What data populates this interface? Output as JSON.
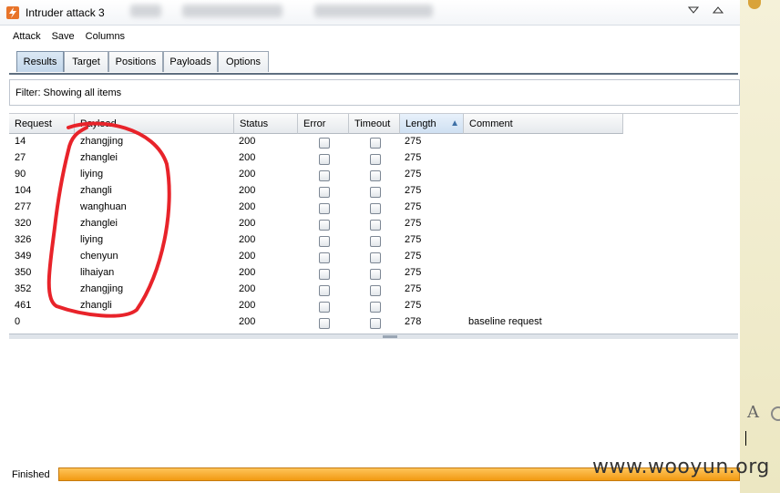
{
  "window": {
    "title": "Intruder attack 3",
    "minimize_icon": "chevron-down-icon",
    "maximize_icon": "chevron-up-icon"
  },
  "menu": {
    "items": [
      "Attack",
      "Save",
      "Columns"
    ]
  },
  "tabs": [
    {
      "label": "Results",
      "active": true
    },
    {
      "label": "Target",
      "active": false
    },
    {
      "label": "Positions",
      "active": false
    },
    {
      "label": "Payloads",
      "active": false
    },
    {
      "label": "Options",
      "active": false
    }
  ],
  "filter": {
    "text": "Filter:  Showing all items"
  },
  "table": {
    "columns": [
      "Request",
      "Payload",
      "Status",
      "Error",
      "Timeout",
      "Length",
      "Comment"
    ],
    "sorted_column": "Length",
    "rows": [
      {
        "request": "14",
        "payload": "zhangjing",
        "status": "200",
        "error": false,
        "timeout": false,
        "length": "275",
        "comment": ""
      },
      {
        "request": "27",
        "payload": "zhanglei",
        "status": "200",
        "error": false,
        "timeout": false,
        "length": "275",
        "comment": ""
      },
      {
        "request": "90",
        "payload": "liying",
        "status": "200",
        "error": false,
        "timeout": false,
        "length": "275",
        "comment": ""
      },
      {
        "request": "104",
        "payload": "zhangli",
        "status": "200",
        "error": false,
        "timeout": false,
        "length": "275",
        "comment": ""
      },
      {
        "request": "277",
        "payload": "wanghuan",
        "status": "200",
        "error": false,
        "timeout": false,
        "length": "275",
        "comment": ""
      },
      {
        "request": "320",
        "payload": "zhanglei",
        "status": "200",
        "error": false,
        "timeout": false,
        "length": "275",
        "comment": ""
      },
      {
        "request": "326",
        "payload": "liying",
        "status": "200",
        "error": false,
        "timeout": false,
        "length": "275",
        "comment": ""
      },
      {
        "request": "349",
        "payload": "chenyun",
        "status": "200",
        "error": false,
        "timeout": false,
        "length": "275",
        "comment": ""
      },
      {
        "request": "350",
        "payload": "lihaiyan",
        "status": "200",
        "error": false,
        "timeout": false,
        "length": "275",
        "comment": ""
      },
      {
        "request": "352",
        "payload": "zhangjing",
        "status": "200",
        "error": false,
        "timeout": false,
        "length": "275",
        "comment": ""
      },
      {
        "request": "461",
        "payload": "zhangli",
        "status": "200",
        "error": false,
        "timeout": false,
        "length": "275",
        "comment": ""
      },
      {
        "request": "0",
        "payload": "",
        "status": "200",
        "error": false,
        "timeout": false,
        "length": "278",
        "comment": "baseline request"
      }
    ]
  },
  "status": {
    "text": "Finished",
    "progress": 1.0
  },
  "watermark": "www.wooyun.org",
  "colors": {
    "progress": "#f29a12",
    "annotation": "#e8232a",
    "accent": "#3e70a6"
  }
}
